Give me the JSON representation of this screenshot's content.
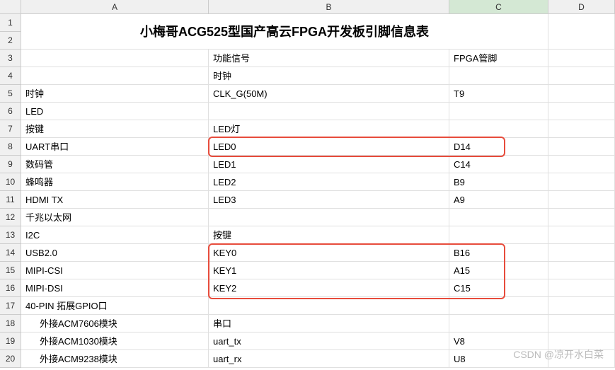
{
  "columns": [
    "A",
    "B",
    "C",
    "D"
  ],
  "title": "小梅哥ACG525型国产高云FPGA开发板引脚信息表",
  "rows": [
    {
      "n": "3",
      "A": "",
      "B": "功能信号",
      "C": "FPGA管脚"
    },
    {
      "n": "4",
      "A": "",
      "B": "时钟",
      "C": ""
    },
    {
      "n": "5",
      "A": "时钟",
      "B": "CLK_G(50M)",
      "C": "T9"
    },
    {
      "n": "6",
      "A": "LED",
      "B": "",
      "C": ""
    },
    {
      "n": "7",
      "A": "按键",
      "B": "LED灯",
      "C": ""
    },
    {
      "n": "8",
      "A": "UART串口",
      "B": "LED0",
      "C": "D14"
    },
    {
      "n": "9",
      "A": "数码管",
      "B": "LED1",
      "C": "C14"
    },
    {
      "n": "10",
      "A": "蜂鸣器",
      "B": "LED2",
      "C": "B9"
    },
    {
      "n": "11",
      "A": "HDMI TX",
      "B": "LED3",
      "C": "A9"
    },
    {
      "n": "12",
      "A": "千兆以太网",
      "B": "",
      "C": ""
    },
    {
      "n": "13",
      "A": "I2C",
      "B": "按键",
      "C": ""
    },
    {
      "n": "14",
      "A": "USB2.0",
      "B": "KEY0",
      "C": "B16"
    },
    {
      "n": "15",
      "A": "MIPI-CSI",
      "B": "KEY1",
      "C": "A15"
    },
    {
      "n": "16",
      "A": "MIPI-DSI",
      "B": "KEY2",
      "C": "C15"
    },
    {
      "n": "17",
      "A": "40-PIN 拓展GPIO口",
      "B": "",
      "C": ""
    },
    {
      "n": "18",
      "A": "外接ACM7606模块",
      "B": "串口",
      "C": "",
      "indent": true
    },
    {
      "n": "19",
      "A": "外接ACM1030模块",
      "B": "uart_tx",
      "C": "V8",
      "indent": true
    },
    {
      "n": "20",
      "A": "外接ACM9238模块",
      "B": "uart_rx",
      "C": "U8",
      "indent": true
    }
  ],
  "title_row_headers": [
    "1",
    "2"
  ],
  "watermark": "CSDN @凉开水白菜"
}
